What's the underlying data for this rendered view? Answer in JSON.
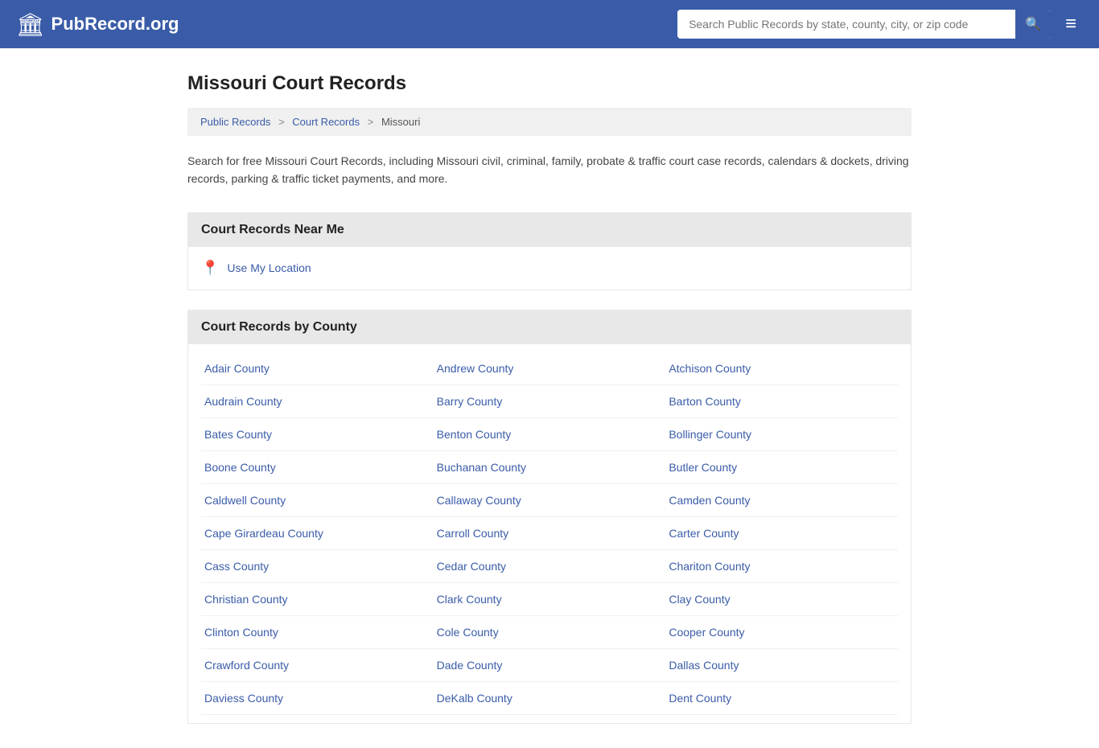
{
  "header": {
    "logo_icon": "🏛",
    "logo_text": "PubRecord.org",
    "search_placeholder": "Search Public Records by state, county, city, or zip code",
    "search_btn_icon": "🔍",
    "menu_icon": "≡"
  },
  "page": {
    "title": "Missouri Court Records",
    "breadcrumb": {
      "items": [
        {
          "label": "Public Records",
          "href": "#"
        },
        {
          "label": "Court Records",
          "href": "#"
        },
        {
          "label": "Missouri",
          "href": "#"
        }
      ]
    },
    "description": "Search for free Missouri Court Records, including Missouri civil, criminal, family, probate & traffic court case records, calendars & dockets, driving records, parking & traffic ticket payments, and more.",
    "near_me": {
      "section_title": "Court Records Near Me",
      "use_location_label": "Use My Location"
    },
    "by_county": {
      "section_title": "Court Records by County",
      "counties": [
        "Adair County",
        "Andrew County",
        "Atchison County",
        "Audrain County",
        "Barry County",
        "Barton County",
        "Bates County",
        "Benton County",
        "Bollinger County",
        "Boone County",
        "Buchanan County",
        "Butler County",
        "Caldwell County",
        "Callaway County",
        "Camden County",
        "Cape Girardeau County",
        "Carroll County",
        "Carter County",
        "Cass County",
        "Cedar County",
        "Chariton County",
        "Christian County",
        "Clark County",
        "Clay County",
        "Clinton County",
        "Cole County",
        "Cooper County",
        "Crawford County",
        "Dade County",
        "Dallas County",
        "Daviess County",
        "DeKalb County",
        "Dent County"
      ]
    }
  }
}
